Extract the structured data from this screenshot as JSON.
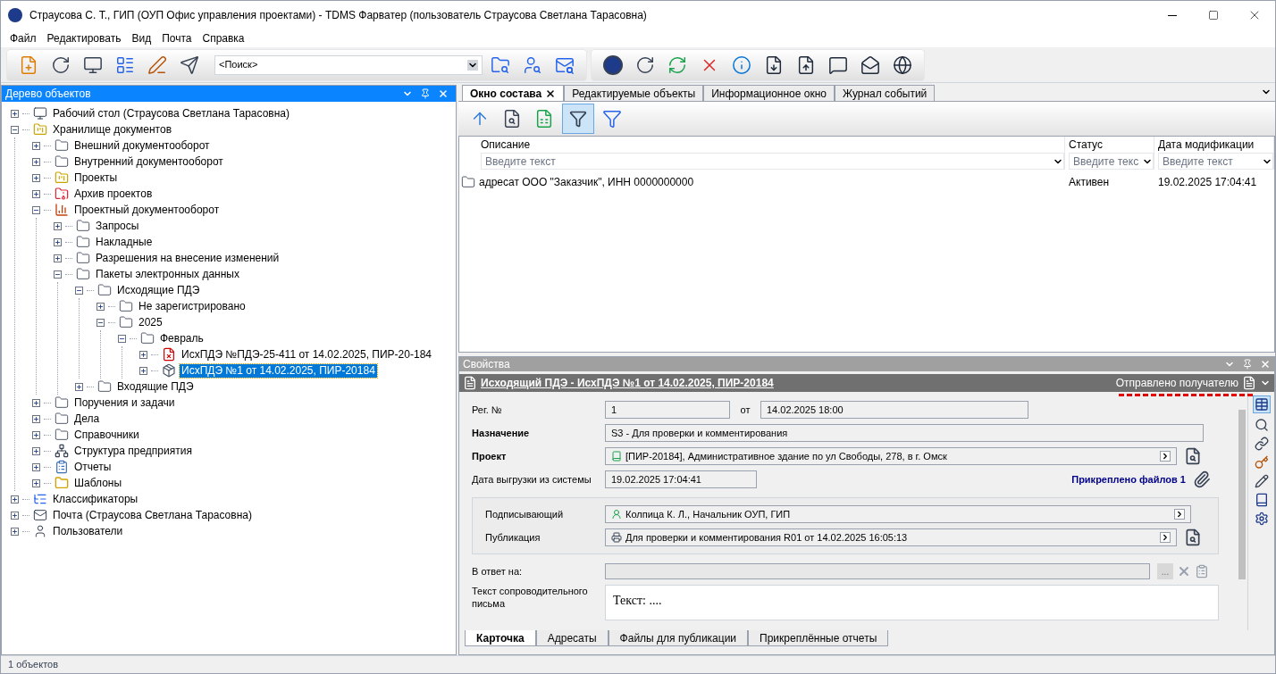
{
  "window": {
    "title": "Страусова С. Т., ГИП (ОУП Офис управления проектами) - TDMS Фарватер (пользователь Страусова Светлана Тарасовна)"
  },
  "menu": [
    "Файл",
    "Редактировать",
    "Вид",
    "Почта",
    "Справка"
  ],
  "search": {
    "value": "<Поиск>"
  },
  "tree_panel": {
    "title": "Дерево объектов",
    "items": [
      {
        "label": "Рабочий стол (Страусова Светлана Тарасовна)",
        "kind": "desktop",
        "expanded": false,
        "selected": false
      },
      {
        "label": "Хранилище документов",
        "kind": "storage",
        "expanded": true,
        "selected": false,
        "children": [
          {
            "label": "Внешний документооборот",
            "kind": "folder",
            "expanded": false,
            "selected": false
          },
          {
            "label": "Внутренний документооборот",
            "kind": "folder",
            "expanded": false,
            "selected": false
          },
          {
            "label": "Проекты",
            "kind": "storage",
            "expanded": false,
            "selected": false
          },
          {
            "label": "Архив проектов",
            "kind": "archive",
            "expanded": false,
            "selected": false
          },
          {
            "label": "Проектный документооборот",
            "kind": "chart",
            "expanded": true,
            "selected": false,
            "children": [
              {
                "label": "Запросы",
                "kind": "folder",
                "expanded": false,
                "selected": false
              },
              {
                "label": "Накладные",
                "kind": "folder",
                "expanded": false,
                "selected": false
              },
              {
                "label": "Разрешения на внесение изменений",
                "kind": "folder",
                "expanded": false,
                "selected": false
              },
              {
                "label": "Пакеты электронных данных",
                "kind": "folder",
                "expanded": true,
                "selected": false,
                "children": [
                  {
                    "label": "Исходящие ПДЭ",
                    "kind": "folder",
                    "expanded": true,
                    "selected": false,
                    "children": [
                      {
                        "label": "Не зарегистрировано",
                        "kind": "folder",
                        "expanded": false,
                        "selected": false
                      },
                      {
                        "label": "2025",
                        "kind": "folder",
                        "expanded": true,
                        "selected": false,
                        "children": [
                          {
                            "label": "Февраль",
                            "kind": "folder",
                            "expanded": true,
                            "selected": false,
                            "children": [
                              {
                                "label": "ИсхПДЭ №ПДЭ-25-411 от 14.02.2025, ПИР-20-184",
                                "kind": "package-rejected",
                                "expanded": false,
                                "selected": false
                              },
                              {
                                "label": "ИсхПДЭ №1 от 14.02.2025, ПИР-20184",
                                "kind": "package",
                                "expanded": false,
                                "selected": true
                              }
                            ]
                          }
                        ]
                      }
                    ]
                  },
                  {
                    "label": "Входящие ПДЭ",
                    "kind": "folder",
                    "expanded": false,
                    "selected": false
                  }
                ]
              }
            ]
          },
          {
            "label": "Поручения и задачи",
            "kind": "folder",
            "expanded": false,
            "selected": false
          },
          {
            "label": "Дела",
            "kind": "folder",
            "expanded": false,
            "selected": false
          },
          {
            "label": "Справочники",
            "kind": "folder",
            "expanded": false,
            "selected": false
          },
          {
            "label": "Структура предприятия",
            "kind": "org",
            "expanded": false,
            "selected": false
          },
          {
            "label": "Отчеты",
            "kind": "report",
            "expanded": false,
            "selected": false
          },
          {
            "label": "Шаблоны",
            "kind": "templates",
            "expanded": false,
            "selected": false
          }
        ]
      },
      {
        "label": "Классификаторы",
        "kind": "classifier",
        "expanded": false,
        "selected": false
      },
      {
        "label": "Почта (Страусова Светлана Тарасовна)",
        "kind": "mail",
        "expanded": false,
        "selected": false
      },
      {
        "label": "Пользователи",
        "kind": "user",
        "expanded": false,
        "selected": false
      }
    ]
  },
  "tabs": [
    {
      "label": "Окно состава",
      "selected": true,
      "closable": true
    },
    {
      "label": "Редактируемые объекты",
      "selected": false,
      "closable": false
    },
    {
      "label": "Информационное окно",
      "selected": false,
      "closable": false
    },
    {
      "label": "Журнал событий",
      "selected": false,
      "closable": false
    }
  ],
  "table": {
    "columns": [
      {
        "label": "Описание",
        "placeholder": "Введите текст"
      },
      {
        "label": "Статус",
        "placeholder": "Введите текс"
      },
      {
        "label": "Дата модификации",
        "placeholder": "Введите текст"
      }
    ],
    "rows": [
      {
        "cells": [
          "адресат ООО \"Заказчик\", ИНН 0000000000",
          "Активен",
          "19.02.2025 17:04:41"
        ]
      }
    ]
  },
  "properties": {
    "title": "Свойства",
    "object_title": "Исходящий ПДЭ - ИсхПДЭ №1 от 14.02.2025, ПИР-20184",
    "status": "Отправлено получателю",
    "reg_label": "Рег. №",
    "reg_value": "1",
    "from_label": "от",
    "from_value": "14.02.2025 18:00",
    "purpose_label": "Назначение",
    "purpose_value": "S3 - Для проверки и комментирования",
    "project_label": "Проект",
    "project_value": "[ПИР-20184], Административное здание по ул Свободы, 278, в г. Омск",
    "export_label": "Дата выгрузки из системы",
    "export_value": "19.02.2025 17:04:41",
    "attached": "Прикреплено файлов 1",
    "signer_label": "Подписывающий",
    "signer_value": "Колпица К. Л., Начальник ОУП, ГИП",
    "publication_label": "Публикация",
    "publication_value": "Для проверки и комментирования R01 от 14.02.2025 16:05:13",
    "reply_label": "В ответ на:",
    "reply_button": "...",
    "letter_label": "Текст сопроводительного письма",
    "letter_value": "Текст: ....",
    "tabs": [
      {
        "label": "Карточка",
        "selected": true
      },
      {
        "label": "Адресаты",
        "selected": false
      },
      {
        "label": "Файлы для публикации",
        "selected": false
      },
      {
        "label": "Прикреплённые отчеты",
        "selected": false
      }
    ]
  },
  "status_bar": {
    "text": "1 объектов"
  }
}
